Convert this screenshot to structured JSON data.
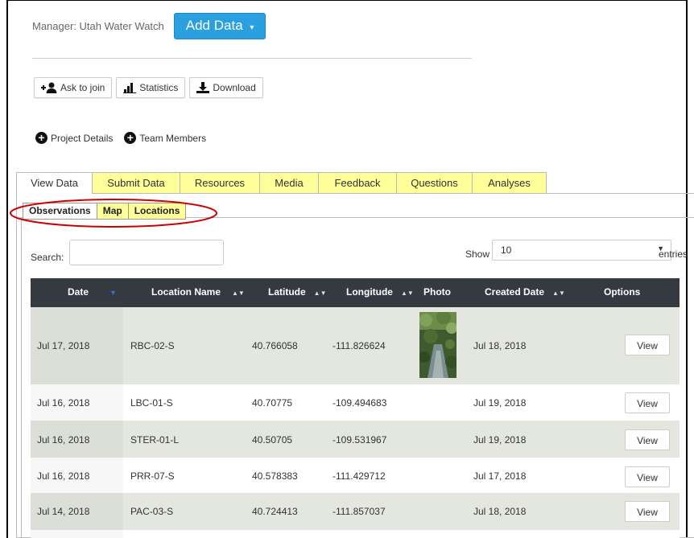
{
  "manager": {
    "label": "Manager: Utah Water Watch"
  },
  "add_data": {
    "label": "Add Data",
    "accent": "#2aa0e0"
  },
  "toolbar": {
    "ask_to_join": "Ask to join",
    "statistics": "Statistics",
    "download": "Download"
  },
  "links": {
    "project_details": "Project Details",
    "team_members": "Team Members"
  },
  "main_tabs": [
    "View Data",
    "Submit Data",
    "Resources",
    "Media",
    "Feedback",
    "Questions",
    "Analyses"
  ],
  "sub_tabs": [
    "Observations",
    "Map",
    "Locations"
  ],
  "search": {
    "label": "Search:",
    "value": ""
  },
  "length": {
    "show": "Show",
    "value": "10",
    "entries": "entries"
  },
  "table": {
    "headers": [
      "Date",
      "Location Name",
      "Latitude",
      "Longitude",
      "Photo",
      "Created Date",
      "Options"
    ],
    "rows": [
      {
        "date": "Jul 17, 2018",
        "location": "RBC-02-S",
        "lat": "40.766058",
        "lon": "-111.826624",
        "created": "Jul 18, 2018",
        "option": "View",
        "has_photo": true
      },
      {
        "date": "Jul 16, 2018",
        "location": "LBC-01-S",
        "lat": "40.70775",
        "lon": "-109.494683",
        "created": "Jul 19, 2018",
        "option": "View",
        "has_photo": false
      },
      {
        "date": "Jul 16, 2018",
        "location": "STER-01-L",
        "lat": "40.50705",
        "lon": "-109.531967",
        "created": "Jul 19, 2018",
        "option": "View",
        "has_photo": false
      },
      {
        "date": "Jul 16, 2018",
        "location": "PRR-07-S",
        "lat": "40.578383",
        "lon": "-111.429712",
        "created": "Jul 17, 2018",
        "option": "View",
        "has_photo": false
      },
      {
        "date": "Jul 14, 2018",
        "location": "PAC-03-S",
        "lat": "40.724413",
        "lon": "-111.857037",
        "created": "Jul 18, 2018",
        "option": "View",
        "has_photo": false
      }
    ]
  },
  "colors": {
    "tab_yellow": "#ffff99",
    "header_dark": "#343a40",
    "row_shade": "#e4e7df",
    "annotation_red": "#d00000"
  }
}
